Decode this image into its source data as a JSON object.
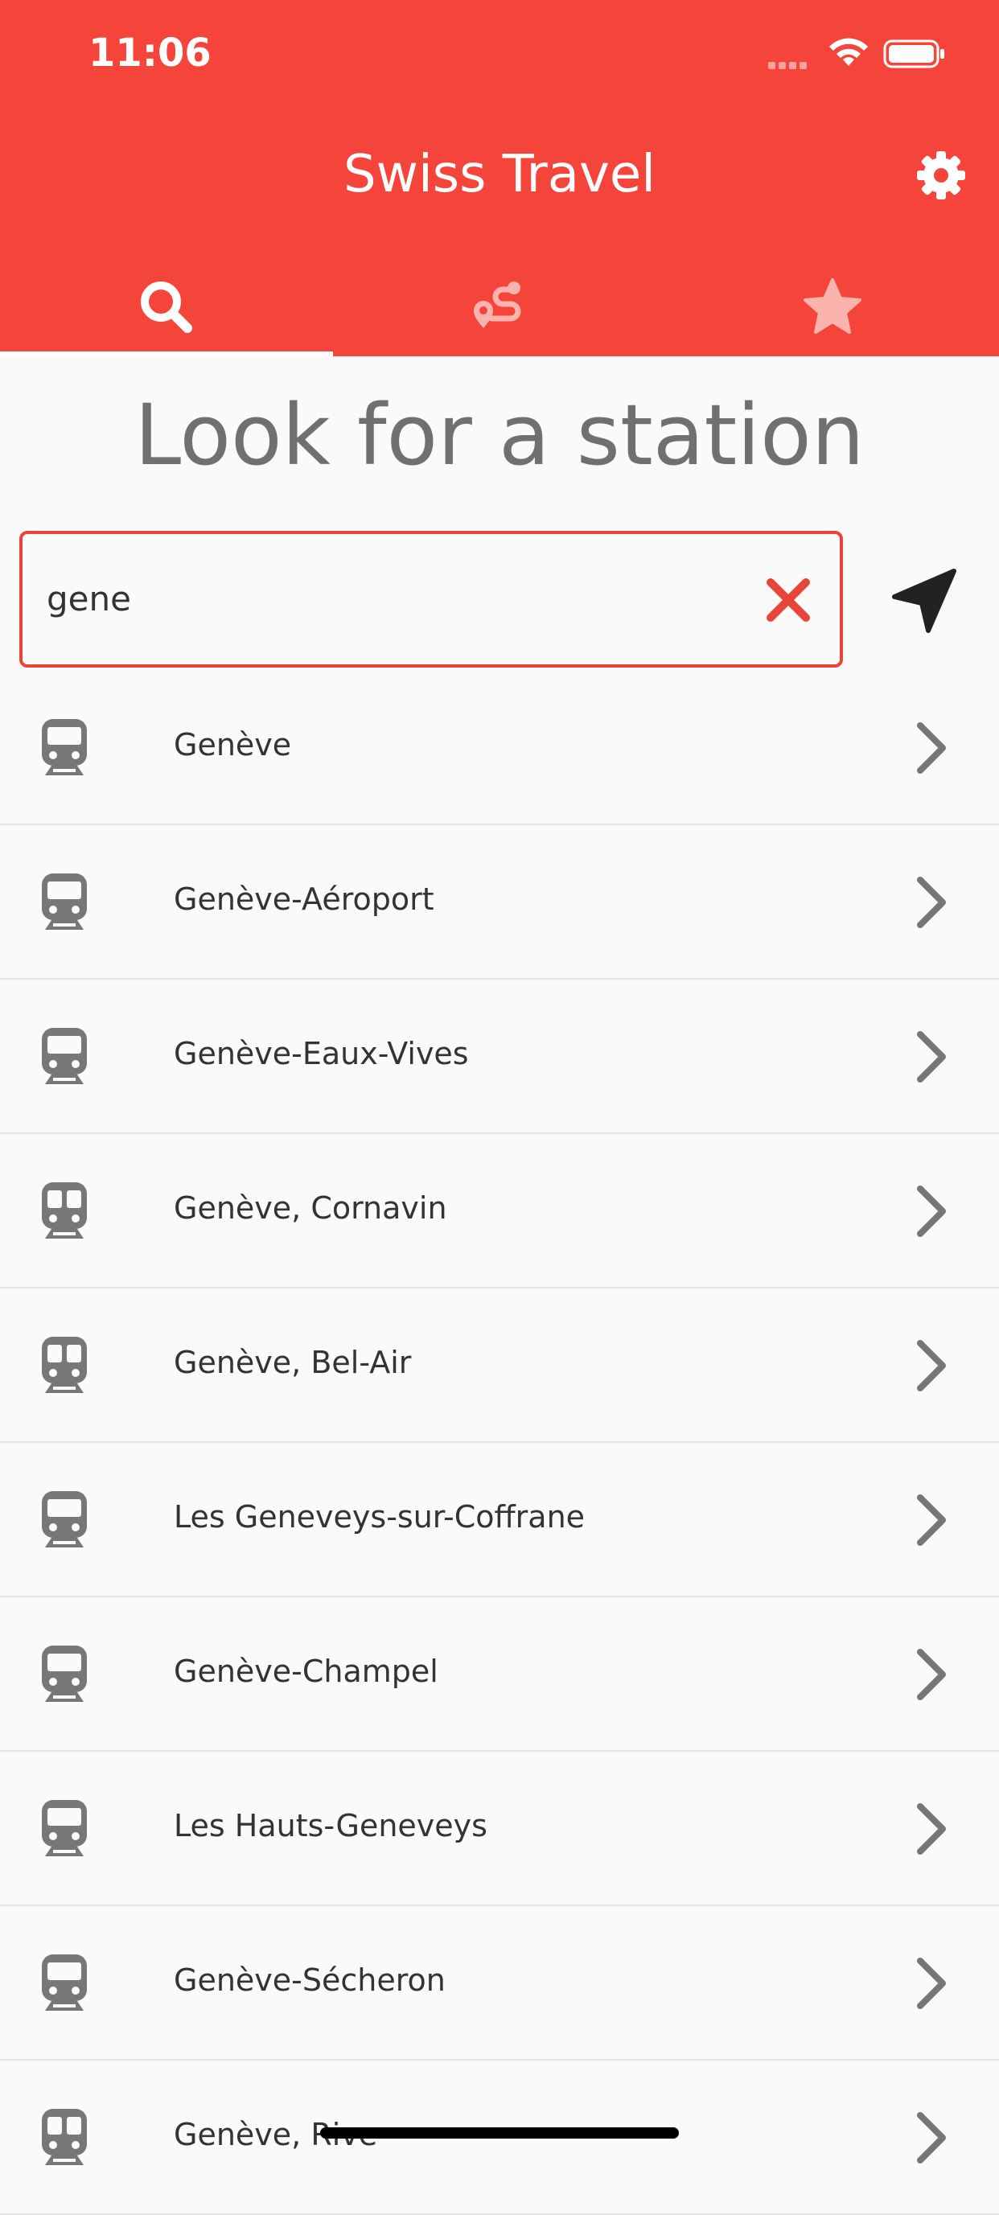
{
  "status_bar": {
    "time": "11:06",
    "wifi_icon": "wifi-icon",
    "battery_icon": "battery-icon"
  },
  "header": {
    "title": "Swiss Travel",
    "settings_icon": "gear-icon",
    "tabs": [
      {
        "icon": "search-icon",
        "active": true
      },
      {
        "icon": "route-icon",
        "active": false
      },
      {
        "icon": "star-icon",
        "active": false
      }
    ],
    "color": "#f5453b"
  },
  "main": {
    "title": "Look for a station",
    "search": {
      "value": "gene"
    }
  },
  "stations": [
    {
      "name": "Genève",
      "icon": "train-icon"
    },
    {
      "name": "Genève-Aéroport",
      "icon": "train-icon"
    },
    {
      "name": "Genève-Eaux-Vives",
      "icon": "train-icon"
    },
    {
      "name": "Genève, Cornavin",
      "icon": "tram-icon"
    },
    {
      "name": "Genève, Bel-Air",
      "icon": "tram-icon"
    },
    {
      "name": "Les Geneveys-sur-Coffrane",
      "icon": "train-icon"
    },
    {
      "name": "Genève-Champel",
      "icon": "train-icon"
    },
    {
      "name": "Les Hauts-Geneveys",
      "icon": "train-icon"
    },
    {
      "name": "Genève-Sécheron",
      "icon": "train-icon"
    },
    {
      "name": "Genève, Rive",
      "icon": "tram-icon"
    }
  ]
}
